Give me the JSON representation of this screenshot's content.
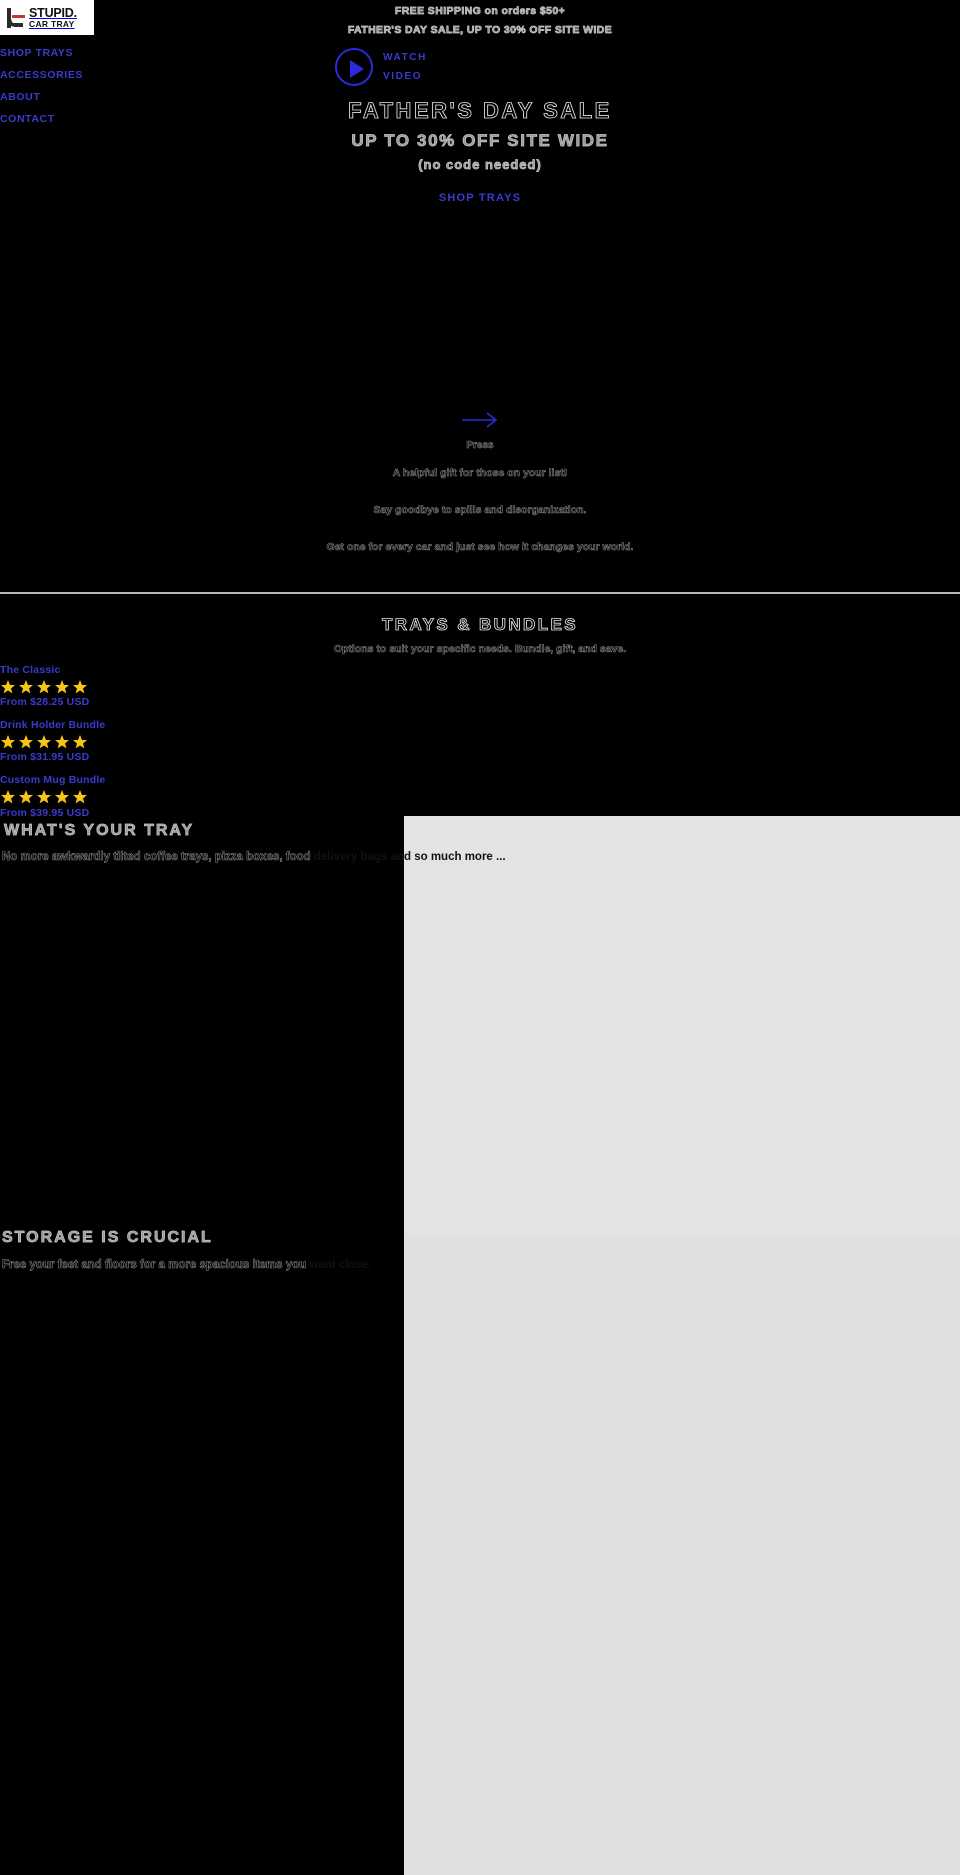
{
  "announcement": {
    "line1": "FREE SHIPPING on orders $50+",
    "line2": "FATHER'S DAY SALE, UP TO 30% OFF SITE WIDE"
  },
  "logo": {
    "top": "STUPID.",
    "bottom": "CAR TRAY",
    "icon": "car-seat-logo-icon"
  },
  "nav": {
    "items": [
      {
        "label": "SHOP TRAYS"
      },
      {
        "label": "ACCESSORIES"
      },
      {
        "label": "ABOUT"
      },
      {
        "label": "CONTACT"
      }
    ]
  },
  "watch_video": {
    "line1": "WATCH",
    "line2": "VIDEO",
    "icon": "play-button-icon"
  },
  "hero": {
    "headline": "FATHER'S DAY SALE",
    "subhead": "UP TO 30% OFF SITE WIDE",
    "note": "(no code needed)",
    "cta": "SHOP TRAYS"
  },
  "midblock": {
    "arrow_icon": "arrow-right-icon",
    "press_label": "Press",
    "line1": "A helpful gift for those on your list!",
    "line2": "Say goodbye to spills and disorganization.",
    "line3": "Get one for every car and just see how it changes your world."
  },
  "bundles": {
    "heading": "TRAYS & BUNDLES",
    "subheading": "Options to suit your specific needs. Bundle, gift, and save.",
    "products": [
      {
        "name": "The Classic",
        "rating": 5,
        "price": "From $28.25 USD"
      },
      {
        "name": "Drink Holder Bundle",
        "rating": 5,
        "price": "From $31.95 USD"
      },
      {
        "name": "Custom Mug Bundle",
        "rating": 5,
        "price": "From $39.95 USD"
      }
    ]
  },
  "whats_your_tray": {
    "heading": "WHAT'S YOUR TRAY",
    "body_ghost": "No more awkwardly tilted coffee trays, pizza boxes, food",
    "body_loaded": "delivery bags and so much more ..."
  },
  "storage": {
    "heading": "STORAGE IS CRUCIAL",
    "body_ghost": "Free your feet and floors for a more spacious items you",
    "body_loaded": "want close."
  },
  "colors": {
    "link_blue": "#3a3ad0",
    "accent_blue": "#2b2bdd",
    "star_gold": "#f5c518",
    "background": "#000000",
    "panel_gray": "#e3e3e3"
  }
}
